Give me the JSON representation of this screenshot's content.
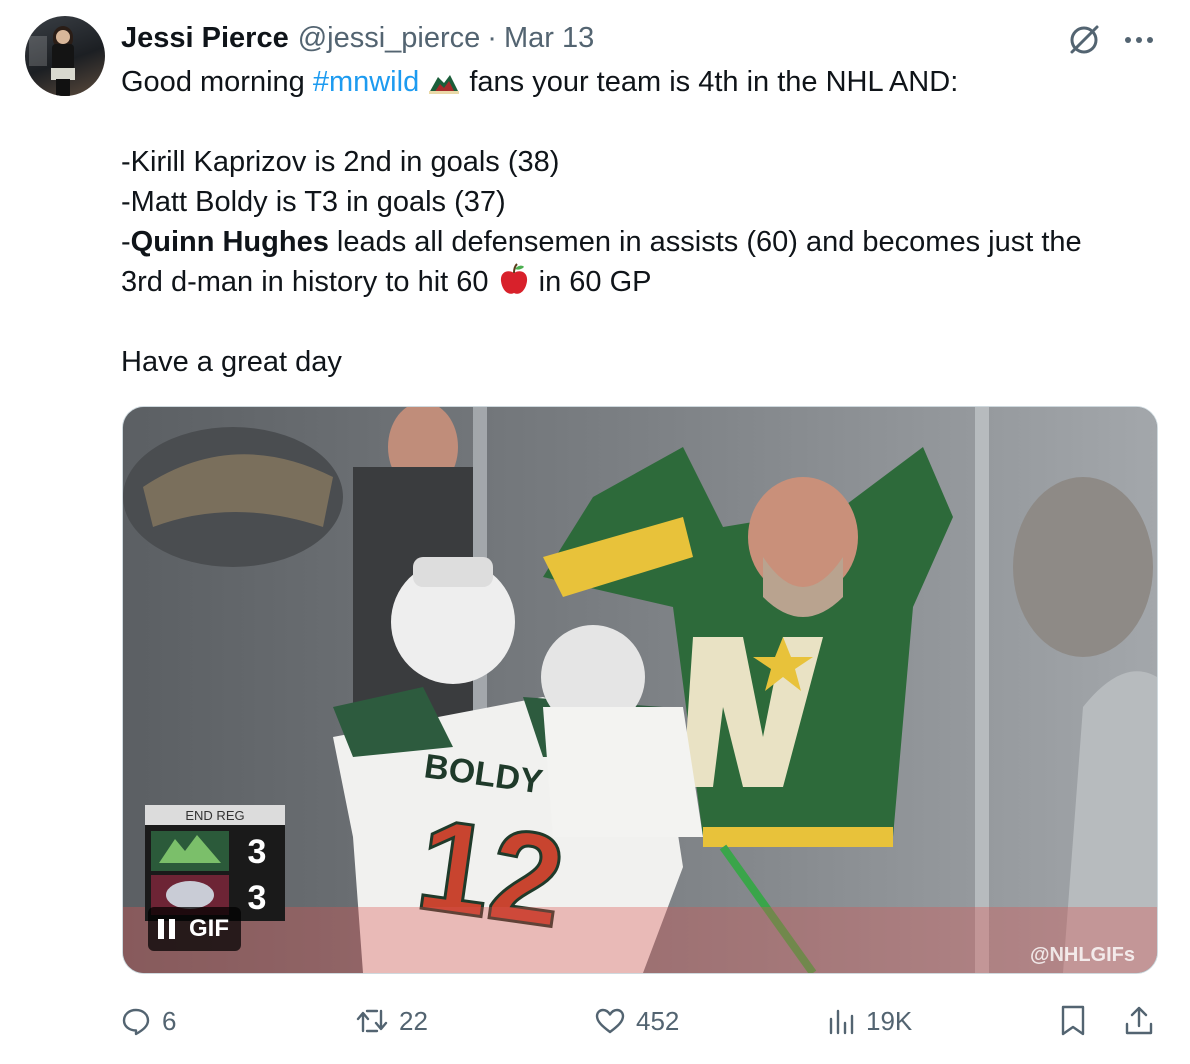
{
  "tweet": {
    "author_name": "Jessi Pierce",
    "handle": "@jessi_pierce",
    "separator": "·",
    "date": "Mar 13",
    "line1_pre": "Good morning ",
    "hashtag": "#mnwild",
    "line1_post": " fans your team is 4th in the NHL AND:",
    "line2": "-Kirill Kaprizov is 2nd in goals (38)",
    "line3": "-Matt Boldy is T3 in goals (37)",
    "line4_pre": "-",
    "line4_bold": "Quinn Hughes",
    "line4_post": " leads all defensemen in assists (60) and becomes just the",
    "line5_pre": "3rd d-man in history to hit 60 ",
    "line5_post": " in 60 GP",
    "line6": "Have a great day"
  },
  "media": {
    "badge_label": "GIF",
    "scoreboard": {
      "period": "END REG",
      "home_score": "3",
      "away_score": "3"
    },
    "jersey_name": "BOLDY",
    "jersey_number": "12",
    "watermark": "@NHLGIFs"
  },
  "actions": {
    "replies": "6",
    "reposts": "22",
    "likes": "452",
    "views": "19K"
  },
  "colors": {
    "text": "#0f1419",
    "secondary": "#536471",
    "link": "#1d9bf0"
  }
}
